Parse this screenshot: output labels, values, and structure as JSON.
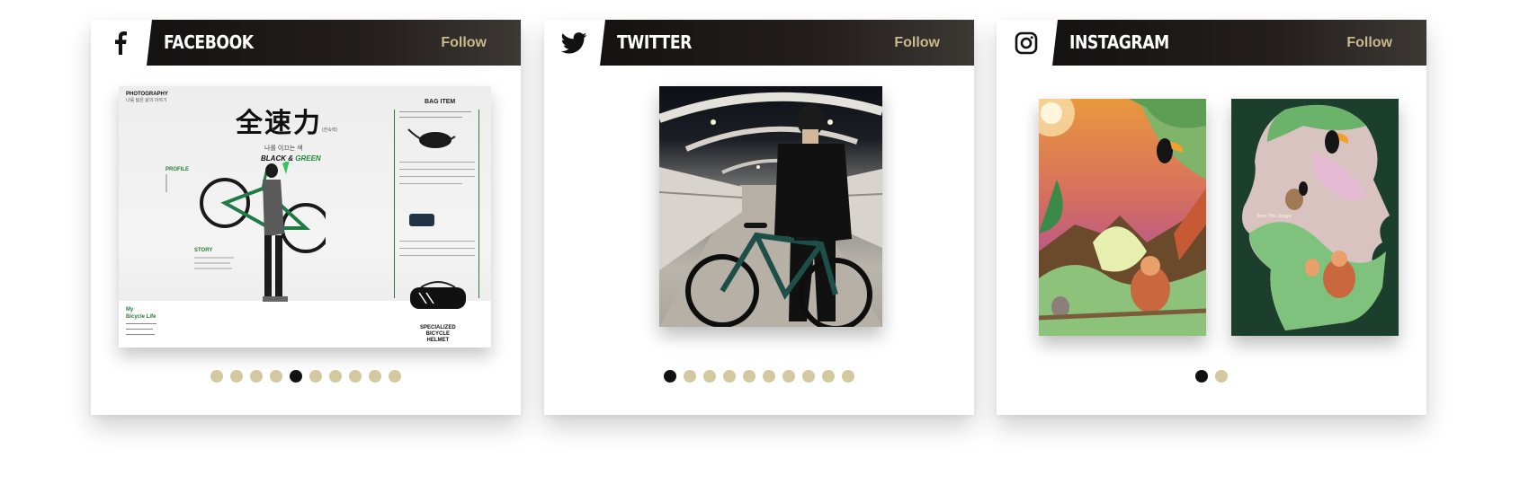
{
  "cards": {
    "facebook": {
      "network": "FACEBOOK",
      "icon": "facebook-icon",
      "follow_label": "Follow",
      "dots_total": 10,
      "dots_active": 5,
      "post": {
        "title": "全速力",
        "title_annot": "(전속력)",
        "subtitle": "나를 이끄는 색",
        "headline_left": "BLACK",
        "headline_amp": "&",
        "headline_right": "GREEN",
        "bag_item": "BAG ITEM",
        "profile_label": "PROFILE",
        "story_label": "STORY",
        "photography": "PHOTOGRAPHY",
        "photography_sub": "나를 닮은 삶의 이야기",
        "my_label": "My",
        "bicycle_life": "Bicycle Life",
        "helmet_line1": "SPECIALIZED",
        "helmet_line2": "BICYCLE",
        "helmet_line3": "HELMET"
      }
    },
    "twitter": {
      "network": "TWITTER",
      "icon": "twitter-bird-icon",
      "follow_label": "Follow",
      "dots_total": 10,
      "dots_active": 1
    },
    "instagram": {
      "network": "INSTAGRAM",
      "icon": "instagram-icon",
      "follow_label": "Follow",
      "dots_total": 2,
      "dots_active": 1,
      "poster_caption": "Save The Jungle"
    }
  },
  "colors": {
    "header_dark": "#141212",
    "follow_gold": "#c9b98d",
    "dot_inactive": "#d3c9a0",
    "dot_active": "#111111"
  }
}
